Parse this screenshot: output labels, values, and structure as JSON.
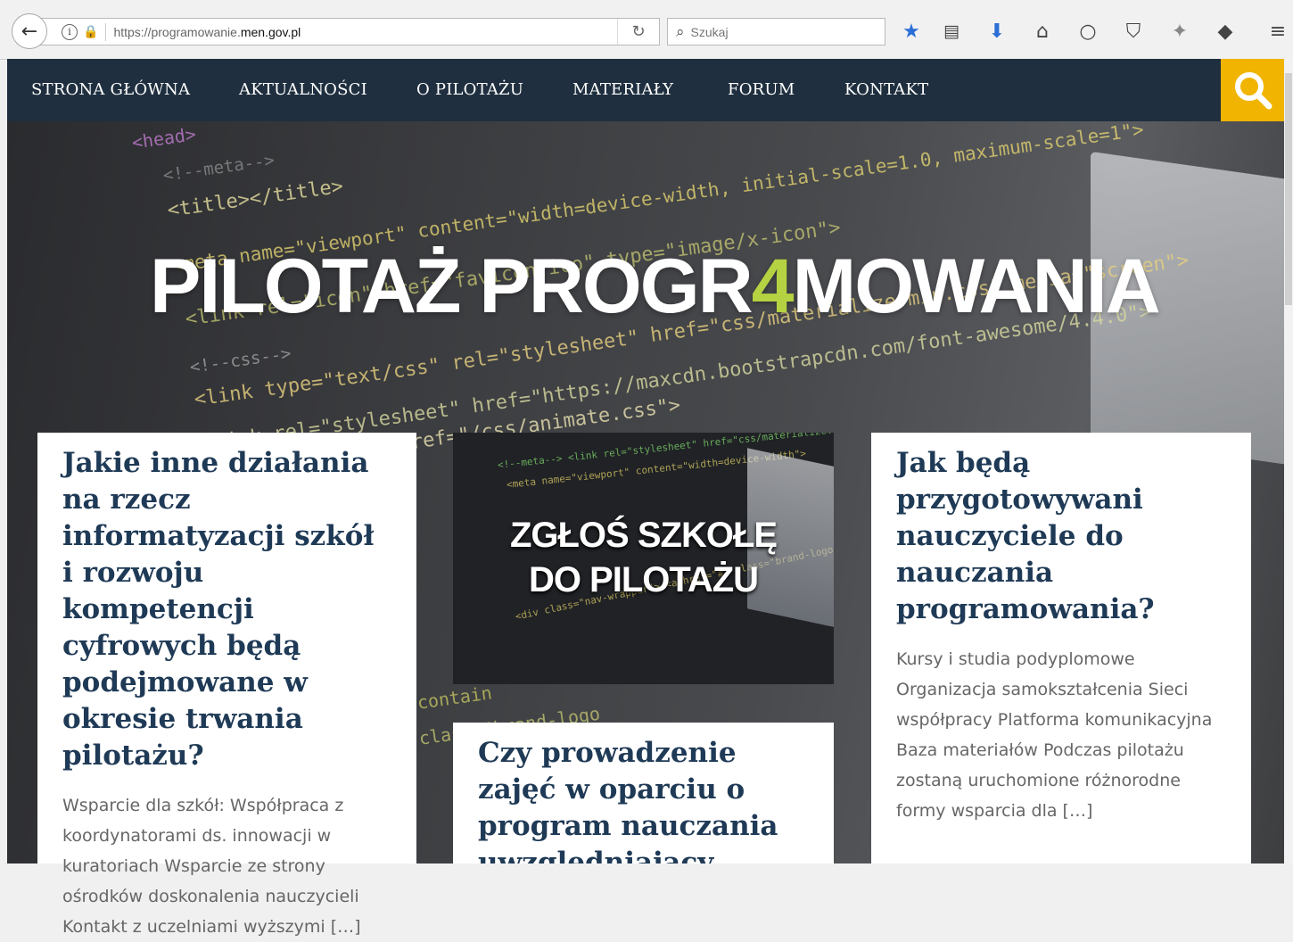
{
  "browser": {
    "url_prefix": "https://programowanie.",
    "url_domain": "men.gov.pl",
    "search_placeholder": "Szukaj"
  },
  "nav": {
    "items": [
      "STRONA GŁÓWNA",
      "AKTUALNOŚCI",
      "O PILOTAŻU",
      "MATERIAŁY",
      "FORUM",
      "KONTAKT"
    ],
    "accent": "#f1b400",
    "background": "#1f2f3f"
  },
  "hero": {
    "title_part1": "PILOTAŻ PROGR",
    "title_highlight": "4",
    "title_part2": "MOWANIA",
    "highlight_color": "#b5d243"
  },
  "cards": [
    {
      "title": "Jakie inne działania na rzecz informatyzacji szkół i rozwoju kompetencji cyfrowych będą podejmowane w okresie trwania pilotażu?",
      "excerpt": "Wsparcie dla szkół: Współpraca z koordynatorami ds. innowacji w kuratoriach Wsparcie ze strony ośrodków doskonalenia nauczycieli Kontakt z uczelniami wyższymi […]"
    },
    {
      "title": "Czy prowadzenie zajęć w oparciu o program nauczania uwzględniający"
    },
    {
      "title": "Jak będą przygotowywani nauczyciele do nauczania programowania?",
      "excerpt": "Kursy i studia podyplomowe Organizacja samokształcenia Sieci współpracy Platforma komunikacyjna Baza materiałów Podczas pilotażu zostaną uruchomione różnorodne formy wsparcia dla […]"
    }
  ],
  "promo": {
    "line1": "ZGŁOŚ SZKOŁĘ",
    "line2": "DO PILOTAŻU"
  },
  "icons": [
    "back-arrow-icon",
    "info-icon",
    "lock-warning-icon",
    "reload-icon",
    "search-icon",
    "bookmark-star-icon",
    "reading-list-icon",
    "download-icon",
    "home-icon",
    "chat-icon",
    "pocket-icon",
    "extension-icon",
    "sync-icon",
    "menu-icon"
  ]
}
